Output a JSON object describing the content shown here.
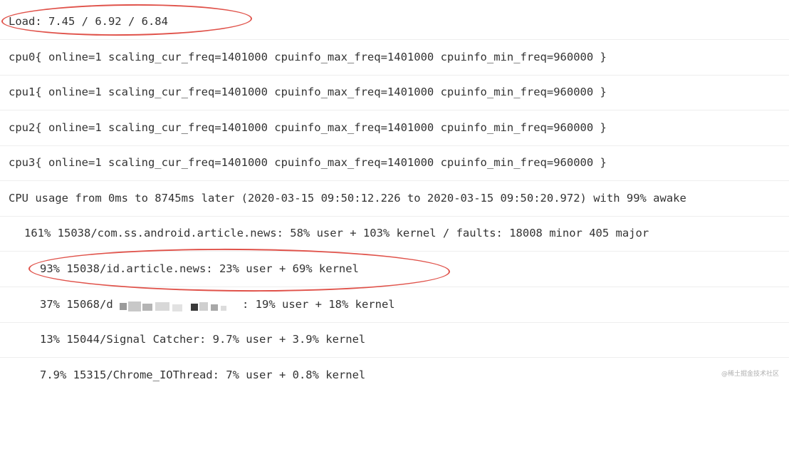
{
  "log": {
    "lines": [
      "Load: 7.45 / 6.92 / 6.84",
      "cpu0{ online=1 scaling_cur_freq=1401000 cpuinfo_max_freq=1401000 cpuinfo_min_freq=960000 }",
      "cpu1{ online=1 scaling_cur_freq=1401000 cpuinfo_max_freq=1401000 cpuinfo_min_freq=960000 }",
      "cpu2{ online=1 scaling_cur_freq=1401000 cpuinfo_max_freq=1401000 cpuinfo_min_freq=960000 }",
      "cpu3{ online=1 scaling_cur_freq=1401000 cpuinfo_max_freq=1401000 cpuinfo_min_freq=960000 }",
      "CPU usage from 0ms to 8745ms later (2020-03-15 09:50:12.226 to 2020-03-15 09:50:20.972) with 99% awake",
      "161% 15038/com.ss.android.article.news: 58% user + 103% kernel / faults: 18008 minor 405 major",
      "93% 15038/id.article.news: 23% user + 69% kernel",
      "37% 15068/d",
      "13% 15044/Signal Catcher: 9.7% user + 3.9% kernel",
      "7.9% 15315/Chrome_IOThread: 7% user + 0.8% kernel"
    ],
    "redacted_line_suffix": ": 19% user + 18% kernel",
    "annotation_color": "#e0524a"
  },
  "watermark": "@稀土掘金技术社区"
}
